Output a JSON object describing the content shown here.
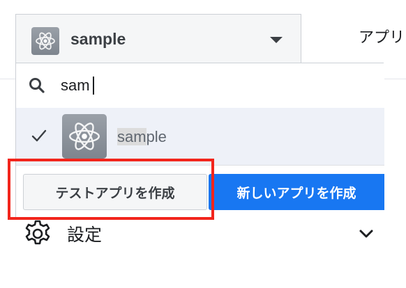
{
  "header": {
    "selected_app_name": "sample",
    "top_tab_label": "アプリ"
  },
  "dropdown": {
    "search": {
      "value": "sam",
      "placeholder": ""
    },
    "results": [
      {
        "name_match": "sam",
        "name_rest": "ple",
        "selected": true
      }
    ],
    "buttons": {
      "create_test_app": "テストアプリを作成",
      "create_new_app": "新しいアプリを作成"
    }
  },
  "settings": {
    "label": "設定"
  },
  "colors": {
    "primary_button": "#1877f2",
    "highlight_border": "#f2251c",
    "selected_row_bg": "#eef1f8"
  },
  "icons": [
    "atom-app-icon",
    "caret-down-icon",
    "search-icon",
    "check-icon",
    "gear-icon",
    "chevron-down-icon"
  ]
}
